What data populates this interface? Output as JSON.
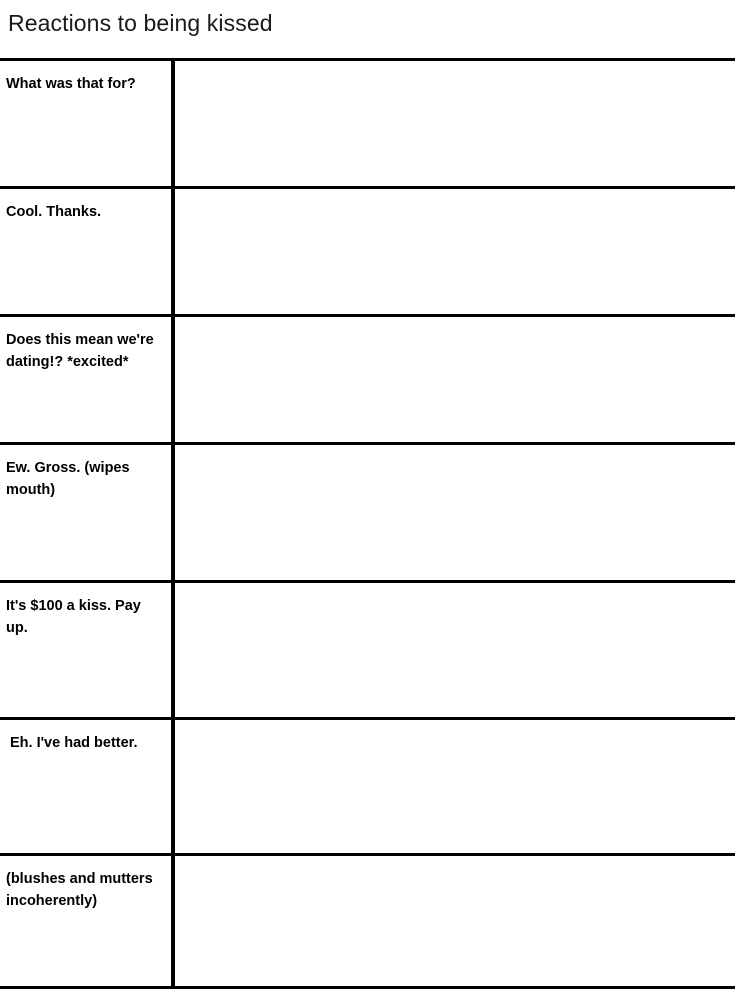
{
  "page": {
    "title": "Reactions to being kissed",
    "background_color": "#ffffff",
    "rule_color": "#000000",
    "text_color": "#000000",
    "title_color": "#1a1a1a"
  },
  "table": {
    "column_count": 2,
    "columns": [
      {
        "name": "prompt",
        "header": ""
      },
      {
        "name": "response",
        "header": ""
      }
    ],
    "rows": [
      {
        "prompt": "What was that for?",
        "response": ""
      },
      {
        "prompt": "Cool. Thanks.",
        "response": ""
      },
      {
        "prompt": "Does this mean we're dating!? *excited*",
        "response": ""
      },
      {
        "prompt": "Ew. Gross. (wipes mouth)",
        "response": ""
      },
      {
        "prompt": "It's $100 a kiss. Pay up.",
        "response": ""
      },
      {
        "prompt": "Eh. I've had better.",
        "response": ""
      },
      {
        "prompt": "(blushes and mutters incoherently)",
        "response": ""
      }
    ]
  }
}
